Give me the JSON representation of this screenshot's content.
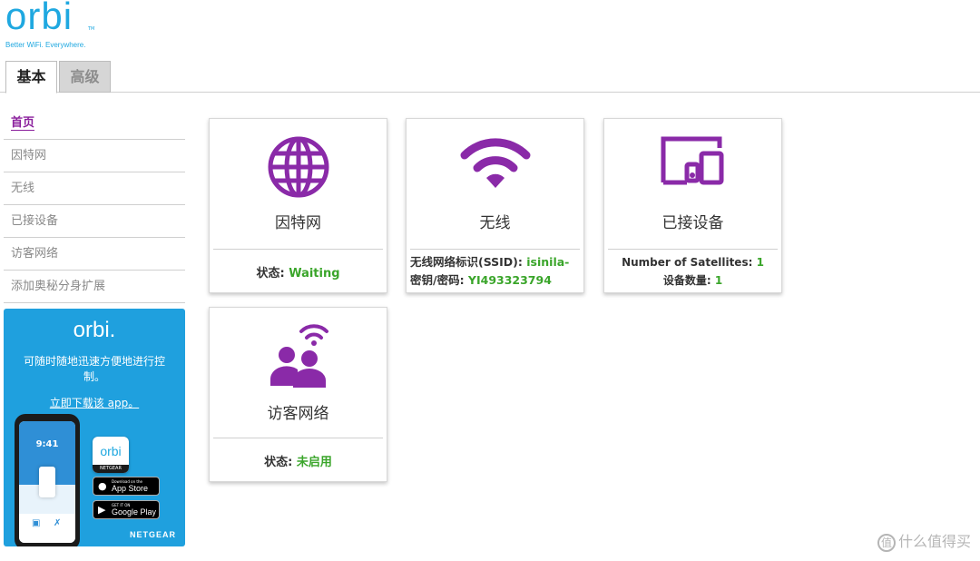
{
  "brand": {
    "logo": "orbi",
    "tm": "TM",
    "tagline": "Better WiFi. Everywhere."
  },
  "tabs": [
    {
      "label": "基本",
      "active": true
    },
    {
      "label": "高级",
      "active": false
    }
  ],
  "sidebar": {
    "items": [
      {
        "label": "首页",
        "active": true
      },
      {
        "label": "因特网"
      },
      {
        "label": "无线"
      },
      {
        "label": "已接设备"
      },
      {
        "label": "访客网络"
      },
      {
        "label": "添加奥秘分身扩展"
      }
    ]
  },
  "promo": {
    "logo": "orbi.",
    "text": "可随时随地迅速方便地进行控制。",
    "link": "立即下载该 app。",
    "phone_time": "9:41",
    "app_logo": "orbi",
    "app_brand": "NETGEAR",
    "app_store_small": "Download on the",
    "app_store": "App Store",
    "google_small": "GET IT ON",
    "google": "Google Play",
    "brand": "NETGEAR"
  },
  "cards": {
    "internet": {
      "icon": "globe-icon",
      "title": "因特网",
      "status_label": "状态: ",
      "status_value": "Waiting"
    },
    "wireless": {
      "icon": "wifi-icon",
      "title": "无线",
      "ssid_label": "无线网络标识(SSID): ",
      "ssid_value": "isinila-",
      "key_label": "密钥/密码: ",
      "key_value": "YI493323794"
    },
    "devices": {
      "icon": "devices-icon",
      "title": "已接设备",
      "satellites_label": "Number of Satellites: ",
      "satellites_value": "1",
      "count_label": "设备数量: ",
      "count_value": "1"
    },
    "guest": {
      "icon": "guest-network-icon",
      "title": "访客网络",
      "status_label": "状态: ",
      "status_value": "未启用"
    }
  },
  "colors": {
    "accent": "#8a2aa8",
    "brand": "#1fa8e0",
    "ok": "#3aa52a"
  },
  "watermark": "什么值得买"
}
